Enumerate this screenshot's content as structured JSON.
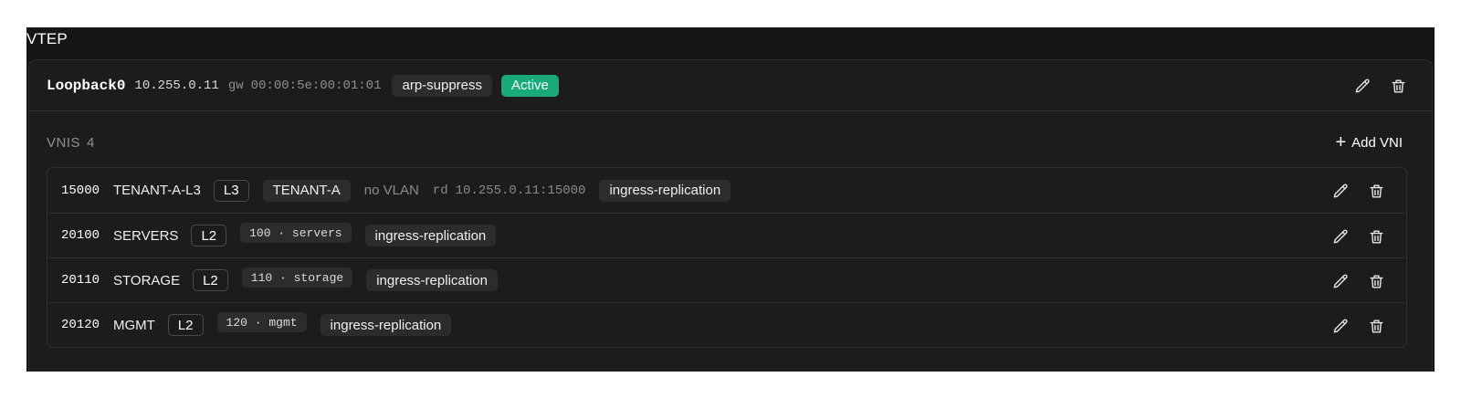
{
  "panel": {
    "title": "VTEP"
  },
  "vtep": {
    "interface": "Loopback0",
    "ip": "10.255.0.11",
    "gw_label": "gw",
    "gw_mac": "00:00:5e:00:01:01",
    "tag": "arp-suppress",
    "status": "Active",
    "status_color": "#1aaa7a",
    "actions": [
      "pencil-icon",
      "trash-icon"
    ]
  },
  "vnis": {
    "label": "VNIS",
    "count": "4",
    "add_label": "Add VNI",
    "rows": [
      {
        "id": "15000",
        "name": "TENANT-A-L3",
        "layer": "L3",
        "tenant": "TENANT-A",
        "vlan_text": "no VLAN",
        "rd_label": "rd",
        "rd_value": "10.255.0.11:15000",
        "replication": "ingress-replication"
      },
      {
        "id": "20100",
        "name": "SERVERS",
        "layer": "L2",
        "vlan": "100 · servers",
        "replication": "ingress-replication"
      },
      {
        "id": "20110",
        "name": "STORAGE",
        "layer": "L2",
        "vlan": "110 · storage",
        "replication": "ingress-replication"
      },
      {
        "id": "20120",
        "name": "MGMT",
        "layer": "L2",
        "vlan": "120 · mgmt",
        "replication": "ingress-replication"
      }
    ]
  }
}
